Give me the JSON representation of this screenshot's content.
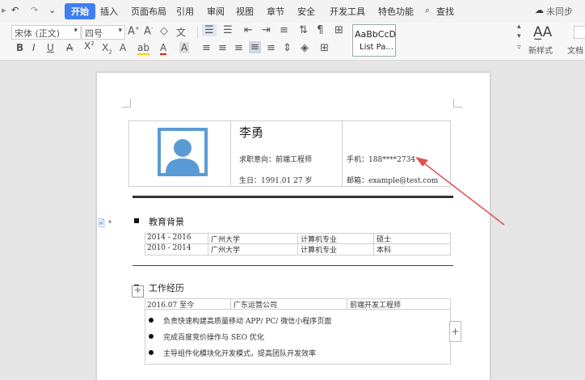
{
  "menu": {
    "quick": [
      "↶",
      "↷",
      "⌄"
    ],
    "tabs": [
      "开始",
      "插入",
      "页面布局",
      "引用",
      "审阅",
      "视图",
      "章节",
      "安全",
      "开发工具",
      "特色功能"
    ],
    "search_label": "查找",
    "sync_label": "未同步"
  },
  "toolbar": {
    "font_name": "宋体 (正文)",
    "font_size": "四号",
    "style_preview": "AaBbCcD",
    "style_name": "List Pa...",
    "new_style_label": "新样式",
    "doc_label": "文档",
    "bold": "B",
    "italic": "I",
    "underline": "U",
    "font_color": "A",
    "highlight": "ab"
  },
  "resume": {
    "name": "李勇",
    "job_intent": "求职意向：前端工程师",
    "birth": "生日：1991.01 27 岁",
    "phone": "手机：188****2734",
    "email": "邮箱：example@test.com",
    "education_title": "教育背景",
    "education": [
      [
        "2014 - 2016",
        "广州大学",
        "计算机专业",
        "硕士"
      ],
      [
        "2010 - 2014",
        "广州大学",
        "计算机专业",
        "本科"
      ]
    ],
    "work_title": "工作经历",
    "work": [
      "2016.07 至今",
      "广东运营公司",
      "前端开发工程师"
    ],
    "duties": [
      "负责快速构建高质量移动 APP/ PC/ 微信小程序页面",
      "完成百度竞价操作与 SEO 优化",
      "主导组件化模块化开发模式，提高团队开发效率"
    ]
  },
  "colors": {
    "accent": "#3d7ff0",
    "avatar": "#5b9bd5",
    "arrow": "#e05050"
  }
}
